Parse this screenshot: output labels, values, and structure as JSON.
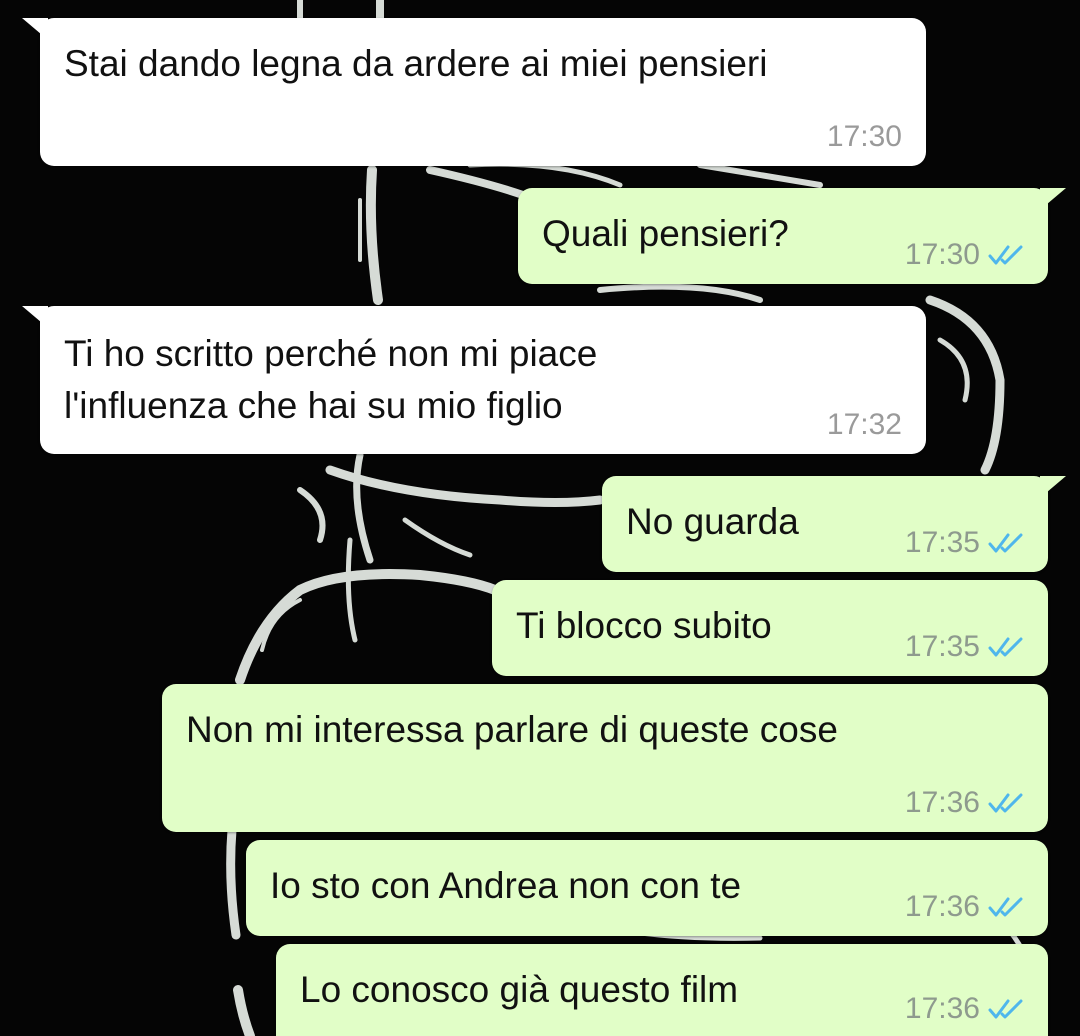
{
  "colors": {
    "incoming_bubble": "#ffffff",
    "outgoing_bubble": "#e1fec7",
    "timestamp": "#8e9a8e",
    "read_ticks": "#4fb6ec",
    "background": "#050505"
  },
  "messages": [
    {
      "direction": "incoming",
      "text": "Stai dando legna da ardere ai miei pensieri",
      "time": "17:30"
    },
    {
      "direction": "outgoing",
      "text": "Quali pensieri?",
      "time": "17:30",
      "status_icon": "double-check-read-icon"
    },
    {
      "direction": "incoming",
      "text": "Ti ho scritto perché non mi piace\nl'influenza che hai su mio figlio",
      "time": "17:32"
    },
    {
      "direction": "outgoing",
      "text": "No guarda",
      "time": "17:35",
      "status_icon": "double-check-read-icon"
    },
    {
      "direction": "outgoing",
      "text": "Ti blocco subito",
      "time": "17:35",
      "status_icon": "double-check-read-icon"
    },
    {
      "direction": "outgoing",
      "text": "Non mi interessa parlare di queste cose",
      "time": "17:36",
      "status_icon": "double-check-read-icon"
    },
    {
      "direction": "outgoing",
      "text": "Io sto con Andrea non con te",
      "time": "17:36",
      "status_icon": "double-check-read-icon"
    },
    {
      "direction": "outgoing",
      "text": "Lo conosco già questo film",
      "time": "17:36",
      "status_icon": "double-check-read-icon"
    }
  ]
}
